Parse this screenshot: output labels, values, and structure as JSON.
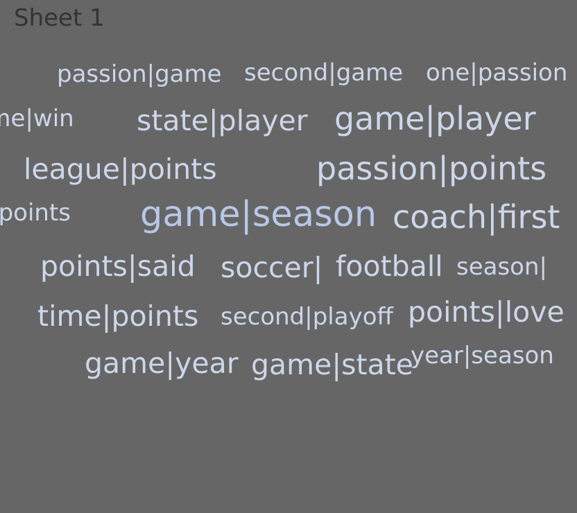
{
  "sheet": {
    "title": "Sheet 1"
  },
  "colors": {
    "background": "#666666",
    "title": "#333333",
    "word": "#ccd7ea",
    "word_strong": "#b8c8e8"
  },
  "chart_data": {
    "type": "word-cloud",
    "words": [
      {
        "text": "passion|game",
        "weight": 3
      },
      {
        "text": "second|game",
        "weight": 3
      },
      {
        "text": "one|passion",
        "weight": 3
      },
      {
        "text": "game|win",
        "weight": 3
      },
      {
        "text": "state|player",
        "weight": 4
      },
      {
        "text": "game|player",
        "weight": 5
      },
      {
        "text": "league|points",
        "weight": 4
      },
      {
        "text": "passion|points",
        "weight": 5
      },
      {
        "text": "state|points",
        "weight": 3
      },
      {
        "text": "game|season",
        "weight": 6
      },
      {
        "text": "coach|first",
        "weight": 5
      },
      {
        "text": "points|said",
        "weight": 4
      },
      {
        "text": "soccer|",
        "weight": 4
      },
      {
        "text": "football",
        "weight": 4
      },
      {
        "text": "season|",
        "weight": 3
      },
      {
        "text": "time|points",
        "weight": 4
      },
      {
        "text": "second|playoff",
        "weight": 3
      },
      {
        "text": "points|love",
        "weight": 4
      },
      {
        "text": "game|year",
        "weight": 4
      },
      {
        "text": "game|state",
        "weight": 4
      },
      {
        "text": "year|season",
        "weight": 3
      }
    ]
  }
}
